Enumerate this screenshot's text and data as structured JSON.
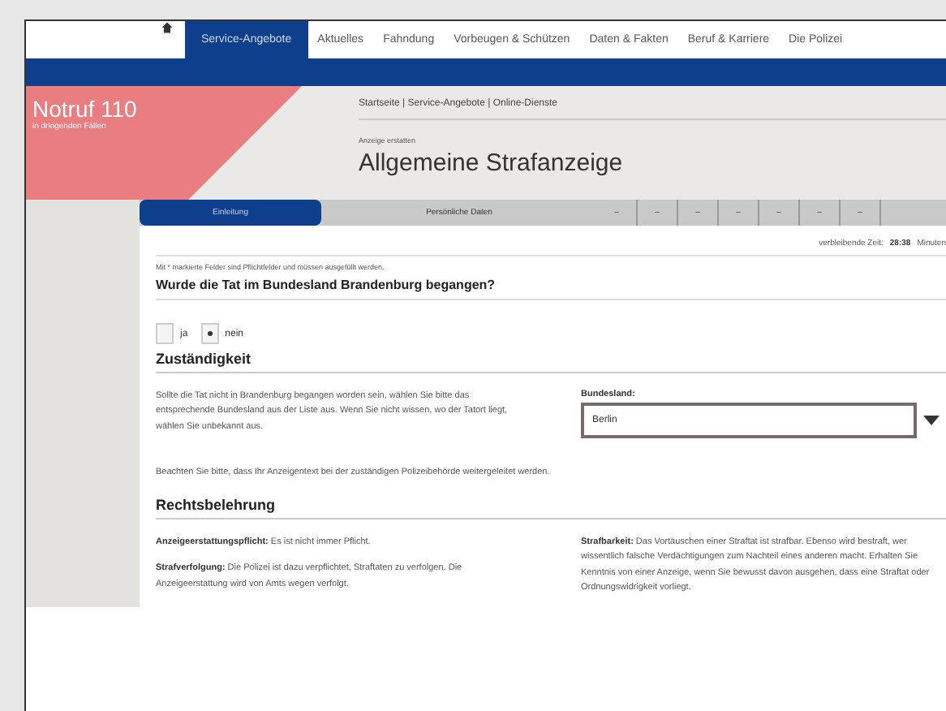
{
  "nav": {
    "items": [
      {
        "label": "Service-Angebote",
        "selected": true
      },
      {
        "label": "Aktuelles",
        "selected": false
      },
      {
        "label": "Fahndung",
        "selected": false
      },
      {
        "label": "Vorbeugen & Schützen",
        "selected": false
      },
      {
        "label": "Daten & Fakten",
        "selected": false
      },
      {
        "label": "Beruf & Karriere",
        "selected": false
      },
      {
        "label": "Die Polizei",
        "selected": false
      }
    ]
  },
  "emergency": {
    "title": "Notruf 110",
    "subtitle": "in dringenden Fällen"
  },
  "breadcrumb": "Startseite | Service-Angebote | Online-Dienste",
  "overline": "Anzeige erstatten",
  "title": "Allgemeine Strafanzeige",
  "steps": [
    {
      "label": "Einleitung",
      "selected": true
    },
    {
      "label": "Persönliche Daten",
      "selected": false
    },
    {
      "label": "–",
      "selected": false
    },
    {
      "label": "–",
      "selected": false
    },
    {
      "label": "–",
      "selected": false
    },
    {
      "label": "–",
      "selected": false
    },
    {
      "label": "–",
      "selected": false
    },
    {
      "label": "–",
      "selected": false
    },
    {
      "label": "–",
      "selected": false
    }
  ],
  "timer": {
    "label": "verbleibende Zeit:",
    "value": "28:38",
    "unit": "Minuten"
  },
  "required_note": "Mit * markierte Felder sind Pflichtfelder und müssen ausgefüllt werden.",
  "question": "Wurde die Tat im Bundesland Brandenburg begangen?",
  "options": [
    {
      "label": "ja",
      "selected": false
    },
    {
      "label": "nein",
      "selected": true
    }
  ],
  "jurisdiction": {
    "heading": "Zuständigkeit",
    "text": "Sollte die Tat nicht in Brandenburg begangen worden sein, wählen Sie bitte das entsprechende Bundesland aus der Liste aus. Wenn Sie nicht wissen, wo der Tatort liegt, wählen Sie unbekannt aus.",
    "field_label": "Bundesland:",
    "value": "Berlin",
    "note": "Beachten Sie bitte, dass Ihr Anzeigentext bei der zuständigen Polizeibehörde weitergeleitet werden."
  },
  "legal": {
    "heading": "Rechtsbelehrung",
    "left": [
      "**Anzeigeerstattungspflicht:** Es ist nicht immer Pflicht.",
      "**Strafverfolgung:** Die Polizei ist dazu verpflichtet, Straftaten zu verfolgen. Die Anzeigeerstattung wird von Amts wegen verfolgt."
    ],
    "right": [
      "**Strafbarkeit:** Das Vortäuschen einer Straftat ist strafbar. Ebenso wird bestraft, wer wissentlich falsche Verdächtigungen zum Nachteil eines anderen macht. Erhalten Sie Kenntnis von einer Anzeige, wenn Sie bewusst davon ausgehen, dass eine Straftat oder Ordnungswidrigkeit vorliegt."
    ]
  }
}
